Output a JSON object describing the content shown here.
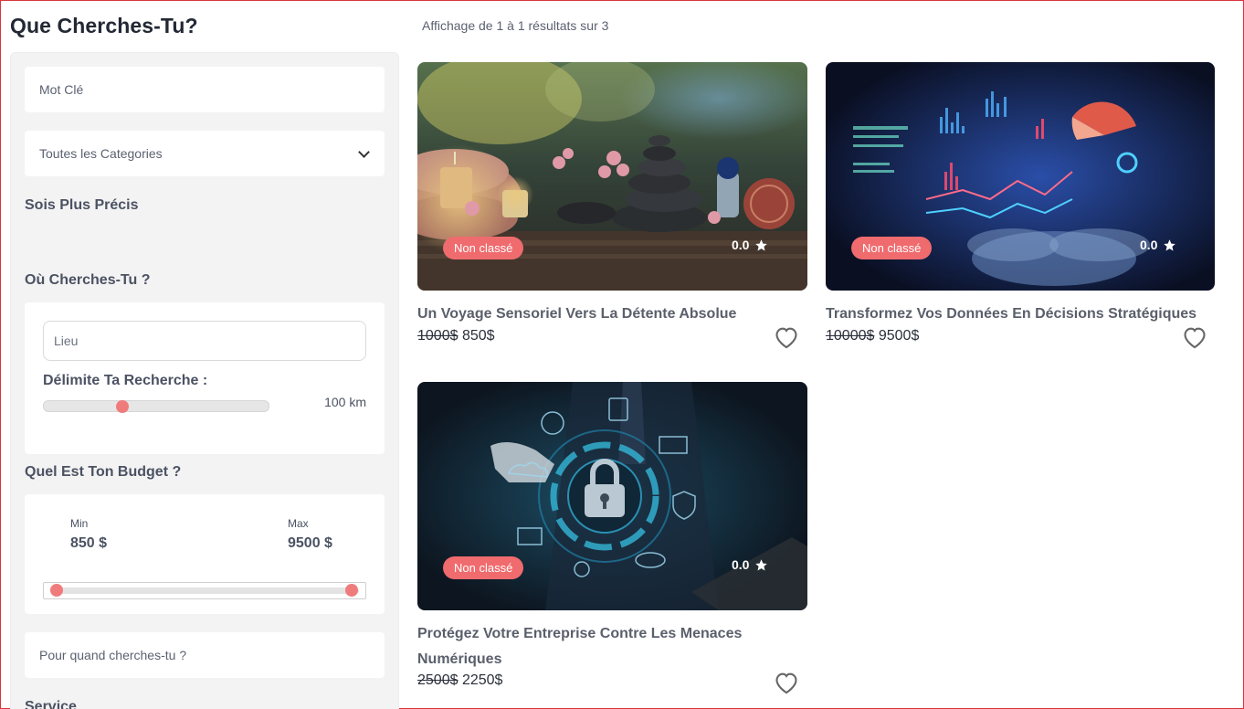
{
  "page_title": "Que Cherches-Tu?",
  "results_count": "Affichage de 1 à 1 résultats sur 3",
  "sidebar": {
    "keyword_placeholder": "Mot Clé",
    "category_select": "Toutes les Categories",
    "precise_title": "Sois Plus Précis",
    "where_title": "Où Cherches-Tu ?",
    "location_placeholder": "Lieu",
    "radius_title": "Délimite Ta Recherche :",
    "radius_value": "100 km",
    "radius_level": 0.35,
    "budget_title": "Quel Est Ton Budget ?",
    "budget_min_label": "Min",
    "budget_min_value": "850 $",
    "budget_max_label": "Max",
    "budget_max_value": "9500 $",
    "when_placeholder": "Pour quand cherches-tu ?",
    "service_title": "Service"
  },
  "cards": [
    {
      "badge": "Non classé",
      "rating": "0.0",
      "title": "Un Voyage Sensoriel Vers La Détente Absolue",
      "old_price": "1000$",
      "price": "850$"
    },
    {
      "badge": "Non classé",
      "rating": "0.0",
      "title": "Transformez Vos Données En Décisions Stratégiques",
      "old_price": "10000$",
      "price": "9500$"
    },
    {
      "badge": "Non classé",
      "rating": "0.0",
      "title": "Protégez Votre Entreprise Contre Les Menaces Numériques",
      "old_price": "2500$",
      "price": "2250$"
    }
  ],
  "colors": {
    "accent": "#ef6b6e",
    "sidebar_bg": "#f3f3f3",
    "text": "#2b2f3a"
  }
}
